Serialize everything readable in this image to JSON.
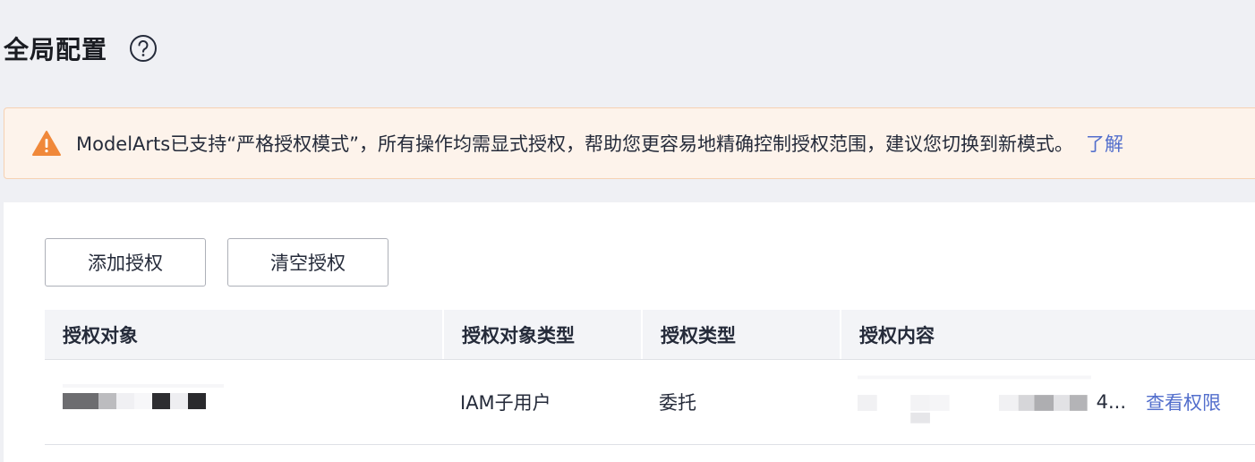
{
  "header": {
    "title": "全局配置"
  },
  "notice": {
    "text": "ModelArts已支持“严格授权模式”，所有操作均需显式授权，帮助您更容易地精确控制授权范围，建议您切换到新模式。",
    "link": "了解"
  },
  "toolbar": {
    "add_label": "添加授权",
    "clear_label": "清空授权"
  },
  "table": {
    "columns": [
      "授权对象",
      "授权对象类型",
      "授权类型",
      "授权内容"
    ],
    "rows": [
      {
        "object": "",
        "object_type": "IAM子用户",
        "auth_type": "委托",
        "content": "4...",
        "action": "查看权限"
      }
    ]
  },
  "colors": {
    "accent": "#526ecc",
    "warning": "#f0883a"
  }
}
